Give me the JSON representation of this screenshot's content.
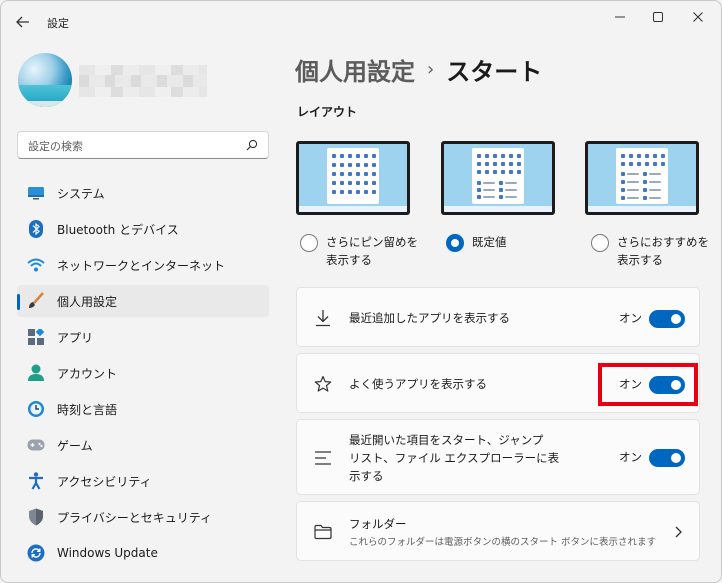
{
  "window": {
    "title": "設定",
    "controls": [
      "minimize-icon",
      "maximize-icon",
      "close-icon"
    ]
  },
  "search": {
    "placeholder": "設定の検索"
  },
  "nav": [
    {
      "label": "システム",
      "icon": "system-icon"
    },
    {
      "label": "Bluetooth とデバイス",
      "icon": "bluetooth-icon"
    },
    {
      "label": "ネットワークとインターネット",
      "icon": "wifi-icon"
    },
    {
      "label": "個人用設定",
      "icon": "brush-icon",
      "active": true
    },
    {
      "label": "アプリ",
      "icon": "apps-icon"
    },
    {
      "label": "アカウント",
      "icon": "account-icon"
    },
    {
      "label": "時刻と言語",
      "icon": "clock-icon"
    },
    {
      "label": "ゲーム",
      "icon": "gamepad-icon"
    },
    {
      "label": "アクセシビリティ",
      "icon": "accessibility-icon"
    },
    {
      "label": "プライバシーとセキュリティ",
      "icon": "shield-icon"
    },
    {
      "label": "Windows Update",
      "icon": "update-icon"
    }
  ],
  "breadcrumb": {
    "parent": "個人用設定",
    "separator": "›",
    "current": "スタート"
  },
  "layout": {
    "title": "レイアウト",
    "options": [
      {
        "label_line1": "さらにピン留めを",
        "label_line2": "表示する",
        "checked": false
      },
      {
        "label_line1": "既定値",
        "label_line2": "",
        "checked": true
      },
      {
        "label_line1": "さらにおすすめを",
        "label_line2": "表示する",
        "checked": false
      }
    ]
  },
  "settings": [
    {
      "label": "最近追加したアプリを表示する",
      "state": "オン",
      "on": true,
      "icon": "download-icon"
    },
    {
      "label": "よく使うアプリを表示する",
      "state": "オン",
      "on": true,
      "icon": "star-icon"
    },
    {
      "label_lines": [
        "最近開いた項目をスタート、ジャンプ",
        "リスト、ファイル エクスプローラーに表",
        "示する"
      ],
      "state": "オン",
      "on": true,
      "icon": "list-icon"
    },
    {
      "label": "フォルダー",
      "sublabel": "これらのフォルダーは電源ボタンの横のスタート ボタンに表示されます",
      "icon": "folder-icon"
    }
  ],
  "colors": {
    "accent": "#0067c0",
    "highlight": "#e60012"
  }
}
